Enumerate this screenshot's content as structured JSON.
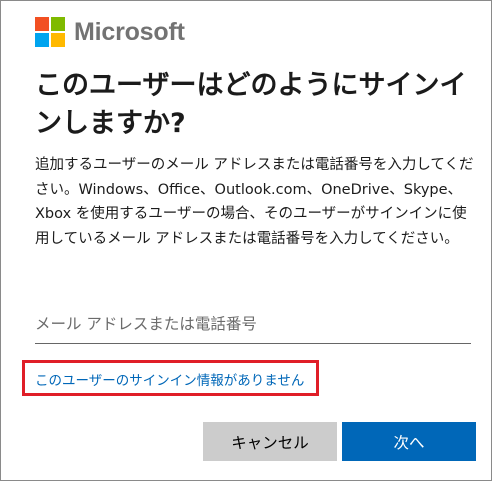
{
  "brand": {
    "name": "Microsoft",
    "colors": [
      "#f25022",
      "#7fba00",
      "#00a4ef",
      "#ffb900"
    ]
  },
  "heading": "このユーザーはどのようにサインインしますか?",
  "description": "追加するユーザーのメール アドレスまたは電話番号を入力してください。Windows、Office、Outlook.com、OneDrive、Skype、Xbox を使用するユーザーの場合、そのユーザーがサインインに使用しているメール アドレスまたは電話番号を入力してください。",
  "input": {
    "value": "",
    "placeholder": "メール アドレスまたは電話番号"
  },
  "link": {
    "label": "このユーザーのサインイン情報がありません",
    "highlight_color": "#e01e28"
  },
  "buttons": {
    "cancel": "キャンセル",
    "next": "次へ"
  },
  "colors": {
    "accent": "#0067b8",
    "cancel_bg": "#cccccc"
  }
}
